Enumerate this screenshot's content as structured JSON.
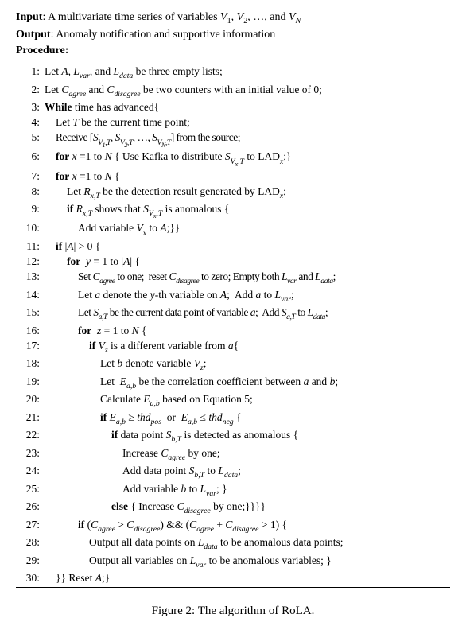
{
  "header": {
    "input_label": "Input",
    "input_text": ": A multivariate time series of variables ",
    "input_vars": "V₁, V₂, …, and V_N",
    "output_label": "Output",
    "output_text": ": Anomaly notification and supportive information",
    "procedure_label": "Procedure:"
  },
  "lines": {
    "l1": "Let A, L_var, and L_data be three empty lists;",
    "l2": "Let C_agree and C_disagree be two counters with an initial value of 0;",
    "l3_kw": "While",
    "l3_rest": " time has advanced{",
    "l4": "Let T be the current time point;",
    "l5": "Receive [S_{V1,T}, S_{V2,T}, …, S_{VN,T}] from the source;",
    "l6_kw": "for",
    "l6_rest": " x =1 to N { Use Kafka to distribute S_{Vx,T} to LAD_x;}",
    "l7_kw": "for",
    "l7_rest": " x =1 to N {",
    "l8": "Let R_{x,T} be the detection result generated by LAD_x;",
    "l9_kw": "if",
    "l9_rest": " R_{x,T} shows that S_{Vx,T} is anomalous {",
    "l10": "Add variable V_x to A;}}",
    "l11_kw": "if",
    "l11_rest": " |A| > 0 {",
    "l12_kw": "for",
    "l12_rest": " y = 1 to |A| {",
    "l13": "Set C_agree to one;  reset C_disagree to zero; Empty both L_var and L_data;",
    "l14": "Let a denote the y-th variable on A;  Add a to L_var;",
    "l15": "Let S_{a,T} be the current data point of variable a;  Add S_{a,T} to L_data;",
    "l16_kw": "for",
    "l16_rest": "  z = 1 to N {",
    "l17_kw": "if",
    "l17_rest": " V_z is a different variable from a{",
    "l18": "Let b denote variable V_z;",
    "l19": "Let  E_{a,b} be the correlation coefficient between a and b;",
    "l20": "Calculate E_{a,b} based on Equation 5;",
    "l21_kw": "if",
    "l21_rest": " E_{a,b} ≥ thd_pos  or  E_{a,b} ≤ thd_neg {",
    "l22_kw": "if",
    "l22_rest": " data point S_{b,T} is detected as anomalous {",
    "l23": "Increase C_agree by one;",
    "l24": "Add data point S_{b,T} to L_data;",
    "l25": "Add variable b to L_var; }",
    "l26_kw": "else",
    "l26_rest": " { Increase C_disagree by one;}}}}",
    "l27_kw": "if",
    "l27_rest": " (C_agree > C_disagree) && (C_agree + C_disagree > 1) {",
    "l28": "Output all data points on L_data to be anomalous data points;",
    "l29": "Output all variables on L_var to be anomalous variables; }",
    "l30": "}} Reset A;}"
  },
  "caption": "Figure 2: The algorithm of RoLA."
}
